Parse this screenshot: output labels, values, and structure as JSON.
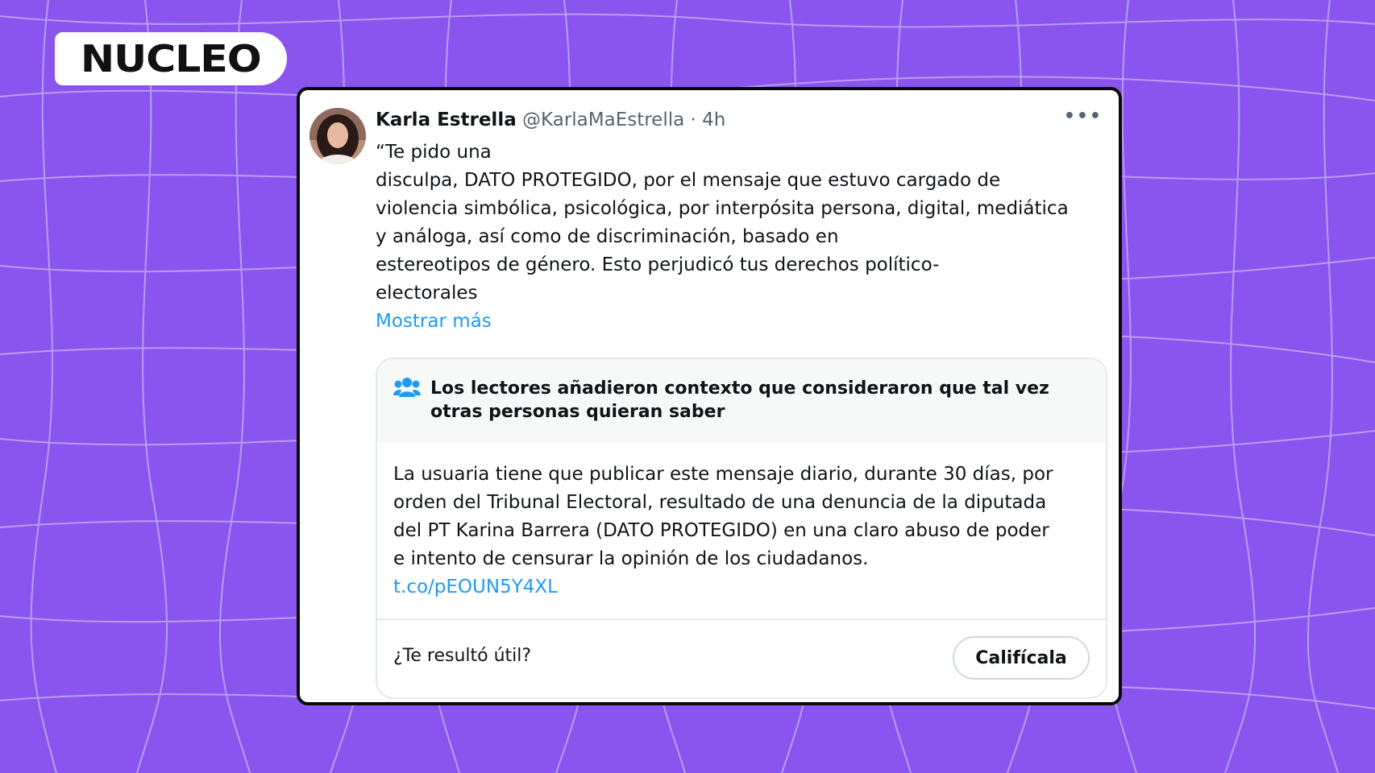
{
  "brand": {
    "logo_text": "NUCLEO"
  },
  "tweet": {
    "author_name": "Karla Estrella",
    "handle": "@KarlaMaEstrella",
    "separator": "·",
    "time": "4h",
    "more_icon": "more-icon",
    "text_lines": [
      "“Te pido una",
      "disculpa, DATO PROTEGIDO, por el mensaje que estuvo cargado de",
      "violencia simbólica, psicológica, por interpósita persona, digital, mediática",
      "y análoga, así como de discriminación, basado en",
      "estereotipos de género. Esto perjudicó tus derechos político-",
      "electorales"
    ],
    "show_more": "Mostrar más"
  },
  "community_note": {
    "icon": "people-icon",
    "title": "Los lectores añadieron contexto que consideraron que tal vez otras personas quieran saber",
    "body_lines": [
      "La usuaria tiene que publicar este mensaje diario, durante 30 días, por",
      "orden del Tribunal Electoral, resultado de una denuncia de la diputada",
      "del PT Karina Barrera (DATO PROTEGIDO) en una claro abuso de poder",
      "e intento de censurar la opinión de los ciudadanos."
    ],
    "link": "t.co/pEOUN5Y4XL",
    "helpful_question": "¿Te resultó útil?",
    "rate_button": "Califícala"
  },
  "colors": {
    "background": "#8a55ee",
    "grid_lines": "#c9b3f7",
    "link": "#1d9bf0",
    "text": "#0f1419",
    "muted": "#536471"
  }
}
